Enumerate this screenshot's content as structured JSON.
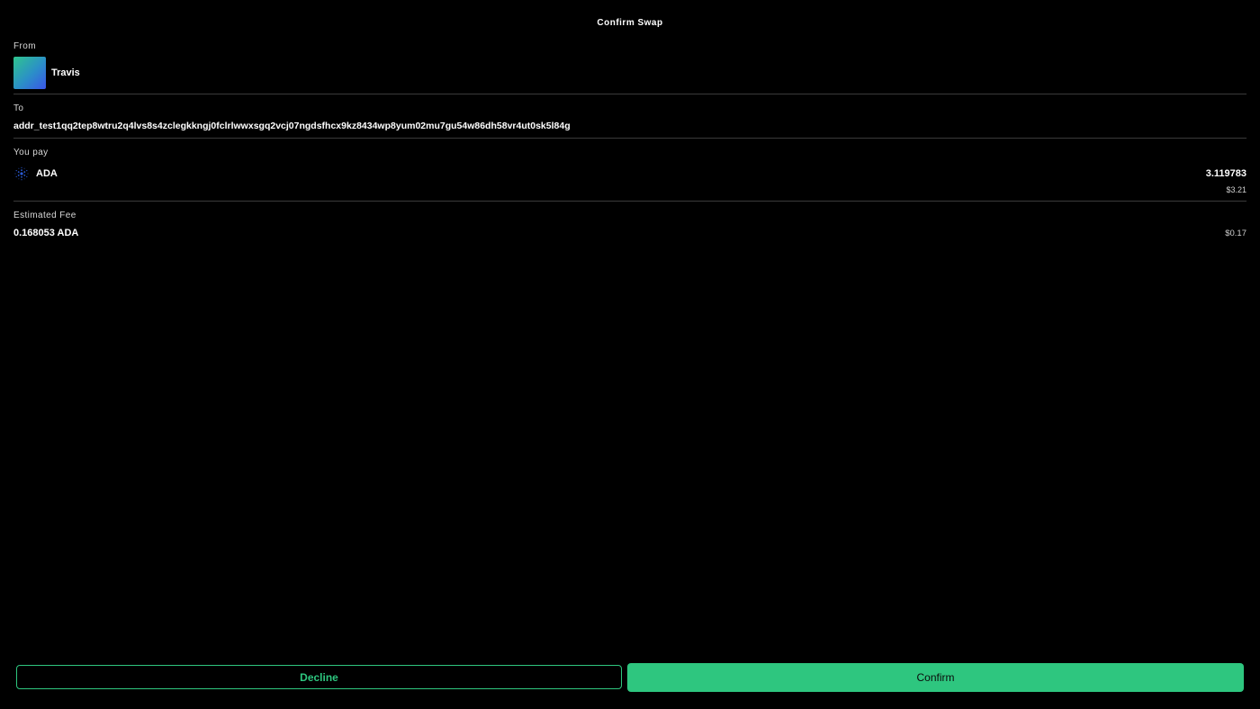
{
  "header": {
    "title": "Confirm Swap"
  },
  "from": {
    "label": "From",
    "name": "Travis",
    "avatar_icon": "gradient-avatar"
  },
  "to": {
    "label": "To",
    "address": "addr_test1qq2tep8wtru2q4lvs8s4zclegkkngj0fclrlwwxsgq2vcj07ngdsfhcx9kz8434wp8yum02mu7gu54w86dh58vr4ut0sk5l84g"
  },
  "pay": {
    "label": "You pay",
    "token_icon": "cardano-icon",
    "token": "ADA",
    "amount": "3.119783",
    "usd": "$3.21"
  },
  "fee": {
    "label": "Estimated Fee",
    "value": "0.168053 ADA",
    "usd": "$0.17"
  },
  "actions": {
    "decline_label": "Decline",
    "confirm_label": "Confirm"
  },
  "colors": {
    "accent": "#2ec67f",
    "background": "#000000",
    "divider": "#3a3a3a"
  }
}
